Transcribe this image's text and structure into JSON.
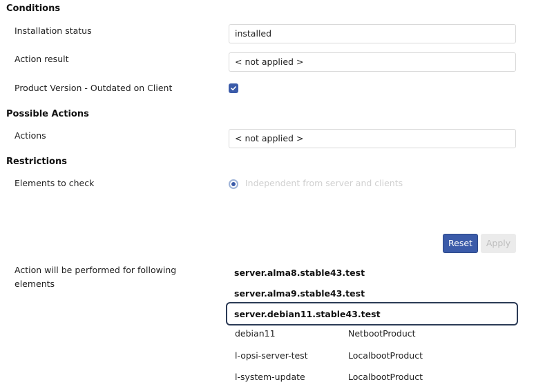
{
  "conditions": {
    "heading": "Conditions",
    "installation_status": {
      "label": "Installation status",
      "value": "installed"
    },
    "action_result": {
      "label": "Action result",
      "value": "< not applied >"
    },
    "outdated": {
      "label": "Product Version - Outdated on Client",
      "checked": true
    }
  },
  "possible_actions": {
    "heading": "Possible Actions",
    "actions": {
      "label": "Actions",
      "value": "< not applied >"
    }
  },
  "restrictions": {
    "heading": "Restrictions",
    "elements_to_check": {
      "label": "Elements to check",
      "option": "Independent from server and clients",
      "selected": true
    }
  },
  "buttons": {
    "reset": "Reset",
    "apply": "Apply"
  },
  "affected": {
    "label": "Action will be performed for following elements",
    "servers": [
      "server.alma8.stable43.test",
      "server.alma9.stable43.test",
      "server.debian11.stable43.test"
    ],
    "selected_server": "server.debian11.stable43.test",
    "products": [
      {
        "name": "debian11",
        "type": "NetbootProduct"
      },
      {
        "name": "l-opsi-server-test",
        "type": "LocalbootProduct"
      },
      {
        "name": "l-system-update",
        "type": "LocalbootProduct"
      }
    ]
  },
  "colors": {
    "accent": "#3b5ba9",
    "selected_border": "#2b3a55",
    "disabled": "#ebebeb"
  }
}
